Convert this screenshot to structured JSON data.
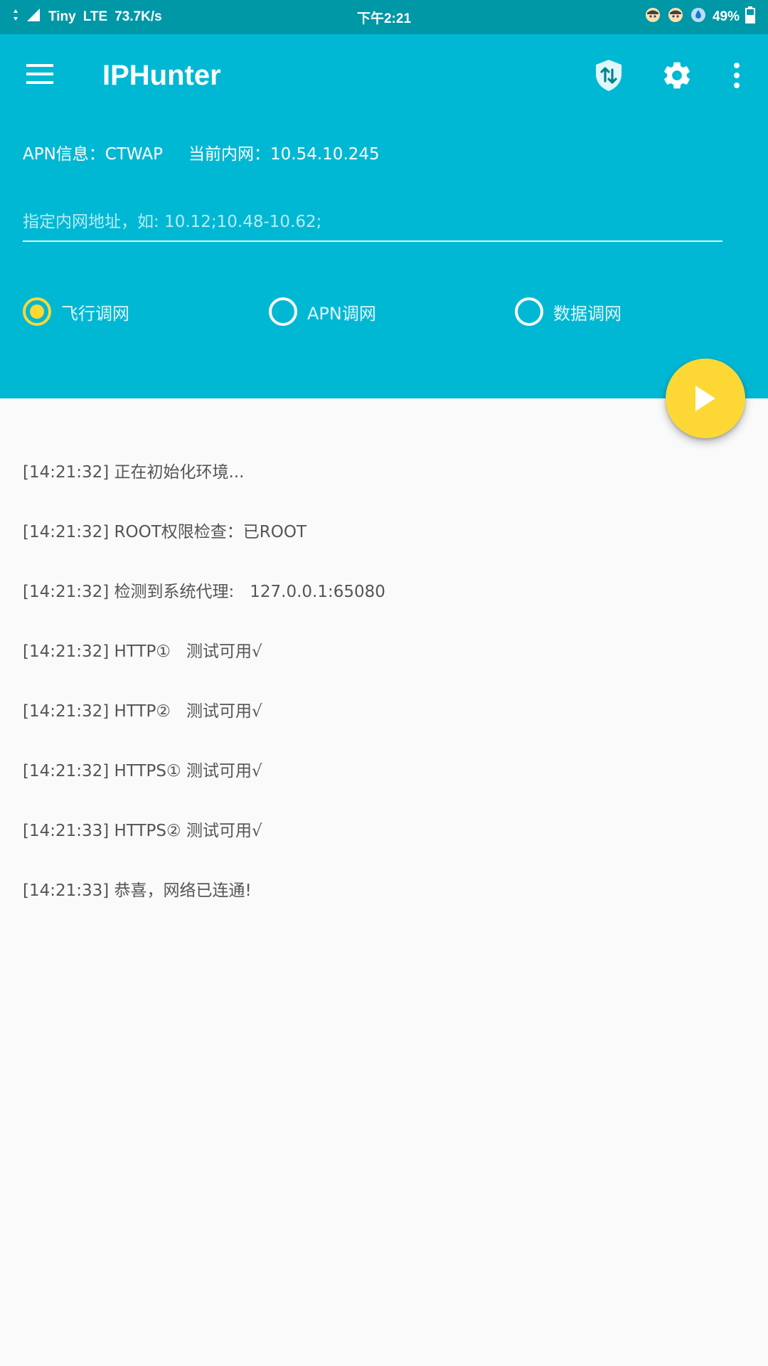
{
  "status_bar": {
    "carrier": "Tiny",
    "network": "LTE",
    "speed": "73.7K/s",
    "time": "下午2:21",
    "battery": "49%"
  },
  "toolbar": {
    "title": "IPHunter"
  },
  "info": {
    "apn": "APN信息：CTWAP",
    "intranet": "当前内网：10.54.10.245"
  },
  "ip_input": {
    "placeholder": "指定内网地址，如: 10.12;10.48-10.62;",
    "value": ""
  },
  "modes": [
    {
      "label": "飞行调网",
      "checked": true
    },
    {
      "label": "APN调网",
      "checked": false
    },
    {
      "label": "数据调网",
      "checked": false
    }
  ],
  "log": [
    "[14:21:32] 正在初始化环境...",
    "[14:21:32] ROOT权限检查：已ROOT",
    "[14:21:32] 检测到系统代理:   127.0.0.1:65080",
    "[14:21:32] HTTP①   测试可用√",
    "[14:21:32] HTTP②   测试可用√",
    "[14:21:32] HTTPS① 测试可用√",
    "[14:21:33] HTTPS② 测试可用√",
    "[14:21:33] 恭喜，网络已连通!"
  ],
  "colors": {
    "status_bar": "#0097a7",
    "header": "#00b8d4",
    "accent": "#fdd835",
    "background": "#fafafa",
    "log_text": "#555555"
  },
  "icons": {
    "menu": "menu-icon",
    "shield": "shield-swap-icon",
    "settings": "gear-icon",
    "more": "more-vertical-icon",
    "play": "play-icon"
  }
}
